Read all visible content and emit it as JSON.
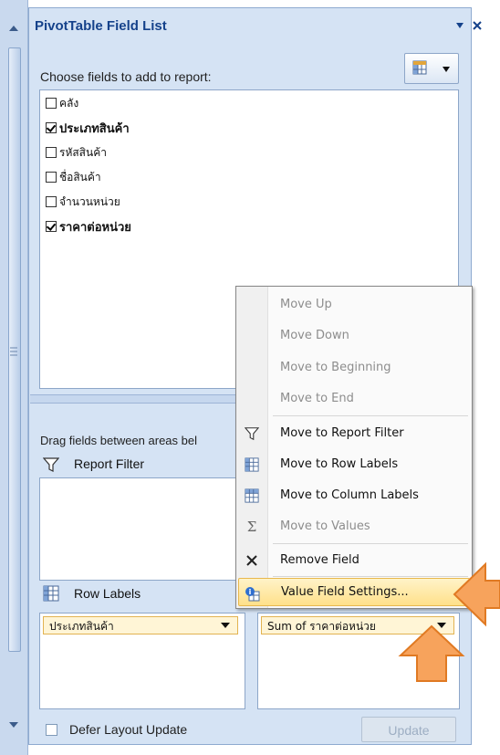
{
  "pane": {
    "title": "PivotTable Field List",
    "choose_label": "Choose fields to add to report:",
    "fields": [
      {
        "label": "คลัง",
        "checked": false
      },
      {
        "label": "ประเภทสินค้า",
        "checked": true
      },
      {
        "label": "รหัสสินค้า",
        "checked": false
      },
      {
        "label": "ชื่อสินค้า",
        "checked": false
      },
      {
        "label": "จำนวนหน่วย",
        "checked": false
      },
      {
        "label": "ราคาต่อหน่วย",
        "checked": true
      }
    ],
    "drag_label": "Drag fields between areas bel",
    "report_filter_label": "Report Filter",
    "row_labels_label": "Row Labels",
    "row_item": "ประเภทสินค้า",
    "value_item": "Sum of ราคาต่อหน่วย",
    "defer_label": "Defer Layout Update",
    "update_label": "Update"
  },
  "menu": {
    "items": [
      {
        "label": "Move Up",
        "disabled": true,
        "icon": ""
      },
      {
        "label": "Move Down",
        "disabled": true,
        "icon": ""
      },
      {
        "label": "Move to Beginning",
        "disabled": true,
        "icon": ""
      },
      {
        "label": "Move to End",
        "disabled": true,
        "icon": ""
      },
      {
        "label": "Move to Report Filter",
        "disabled": false,
        "icon": "filter-icon"
      },
      {
        "label": "Move to Row Labels",
        "disabled": false,
        "icon": "row-labels-icon"
      },
      {
        "label": "Move to Column Labels",
        "disabled": false,
        "icon": "column-labels-icon"
      },
      {
        "label": "Move to Values",
        "disabled": true,
        "icon": "sigma-icon"
      },
      {
        "label": "Remove Field",
        "disabled": false,
        "icon": "remove-icon"
      },
      {
        "label": "Value Field Settings...",
        "disabled": false,
        "icon": "value-settings-icon",
        "highlighted": true
      }
    ]
  },
  "colors": {
    "title_text": "#15428b",
    "pane_bg": "#d5e3f4",
    "highlight": "#ffe08a",
    "arrow": "#f7a35c"
  }
}
